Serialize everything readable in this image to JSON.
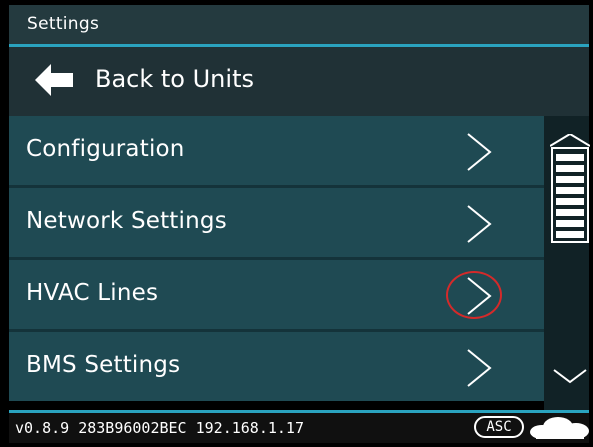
{
  "title_bar": {
    "title": "Settings"
  },
  "back": {
    "label": "Back to Units",
    "icon": "arrow-left-icon"
  },
  "menu": {
    "items": [
      {
        "label": "Configuration",
        "icon": "chevron-right-icon"
      },
      {
        "label": "Network Settings",
        "icon": "chevron-right-icon"
      },
      {
        "label": "HVAC Lines",
        "icon": "chevron-right-icon"
      },
      {
        "label": "BMS Settings",
        "icon": "chevron-right-icon"
      }
    ]
  },
  "scroll": {
    "up_icon": "scroll-up-icon",
    "down_icon": "chevron-down-icon"
  },
  "status": {
    "info": "v0.8.9 283B96002BEC 192.168.1.17",
    "badge": "ASC",
    "cloud_icon": "cloud-icon"
  },
  "colors": {
    "accent": "#2aa3bf",
    "menu_item_bg": "#1f4a53",
    "header_bg": "#243a3f",
    "highlight": "#d42a2a"
  }
}
